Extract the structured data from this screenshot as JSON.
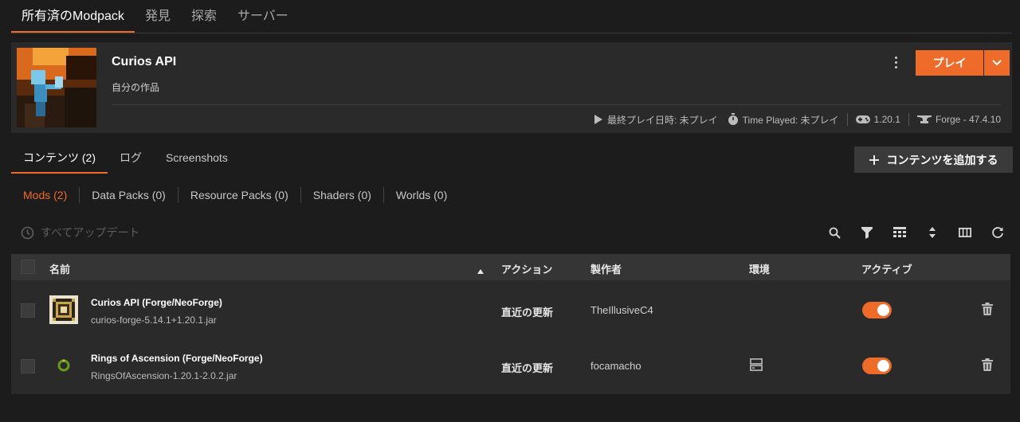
{
  "top_tabs": [
    "所有済のModpack",
    "発見",
    "探索",
    "サーバー"
  ],
  "header": {
    "title": "Curios API",
    "subtitle": "自分の作品",
    "play_label": "プレイ",
    "last_played": "最終プレイ日時: 未プレイ",
    "time_played": "Time Played: 未プレイ",
    "game_version": "1.20.1",
    "loader": "Forge - 47.4.10"
  },
  "content_tabs": [
    "コンテンツ (2)",
    "ログ",
    "Screenshots"
  ],
  "add_content_label": "コンテンツを追加する",
  "filters": [
    "Mods (2)",
    "Data Packs (0)",
    "Resource Packs (0)",
    "Shaders (0)",
    "Worlds (0)"
  ],
  "update_all_label": "すべてアップデート",
  "table": {
    "headers": {
      "name": "名前",
      "action": "アクション",
      "author": "製作者",
      "env": "環境",
      "active": "アクティブ"
    },
    "rows": [
      {
        "name": "Curios API (Forge/NeoForge)",
        "file": "curios-forge-5.14.1+1.20.1.jar",
        "action": "直近の更新",
        "author": "TheIllusiveC4",
        "active": true,
        "icon": "curios-icon"
      },
      {
        "name": "Rings of Ascension (Forge/NeoForge)",
        "file": "RingsOfAscension-1.20.1-2.0.2.jar",
        "action": "直近の更新",
        "author": "focamacho",
        "active": true,
        "icon": "ring-icon"
      }
    ]
  },
  "colors": {
    "accent": "#ee6b2a",
    "background": "#1c1c1c",
    "card": "#2a2a2a",
    "table_header": "#353535"
  }
}
